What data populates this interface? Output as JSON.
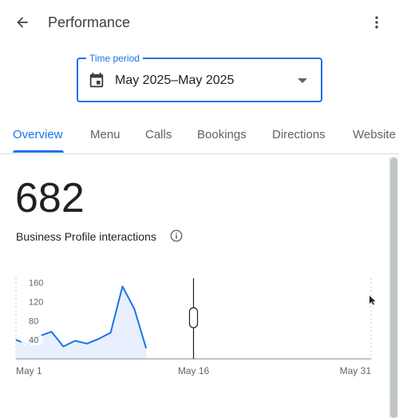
{
  "header": {
    "title": "Performance",
    "back_icon": "arrow-back-icon",
    "more_icon": "more-vert-icon"
  },
  "time_period": {
    "label": "Time period",
    "value": "May 2025–May 2025",
    "icon": "calendar-icon"
  },
  "tabs": [
    {
      "label": "Overview",
      "active": true
    },
    {
      "label": "Menu",
      "active": false
    },
    {
      "label": "Calls",
      "active": false
    },
    {
      "label": "Bookings",
      "active": false
    },
    {
      "label": "Directions",
      "active": false
    },
    {
      "label": "Website",
      "active": false
    }
  ],
  "metric": {
    "value": "682",
    "label": "Business Profile interactions"
  },
  "colors": {
    "accent": "#1a73e8",
    "line": "#1a73e8",
    "area_fill": "#e8f0fe",
    "axis": "#9aa0a6"
  },
  "chart_data": {
    "type": "area",
    "x": [
      1,
      2,
      3,
      4,
      5,
      6,
      7,
      8,
      9,
      10,
      11,
      12
    ],
    "values": [
      40,
      30,
      48,
      57,
      26,
      38,
      32,
      42,
      55,
      152,
      105,
      22
    ],
    "y_ticks": [
      "160",
      "120",
      "80",
      "40"
    ],
    "ylim": [
      0,
      170
    ],
    "x_tick_labels": [
      {
        "day": 1,
        "label": "May 1"
      },
      {
        "day": 16,
        "label": "May 16"
      },
      {
        "day": 31,
        "label": "May 31"
      }
    ],
    "xlim": [
      1,
      31
    ],
    "title": "",
    "xlabel": "",
    "ylabel": "",
    "grid": false
  }
}
